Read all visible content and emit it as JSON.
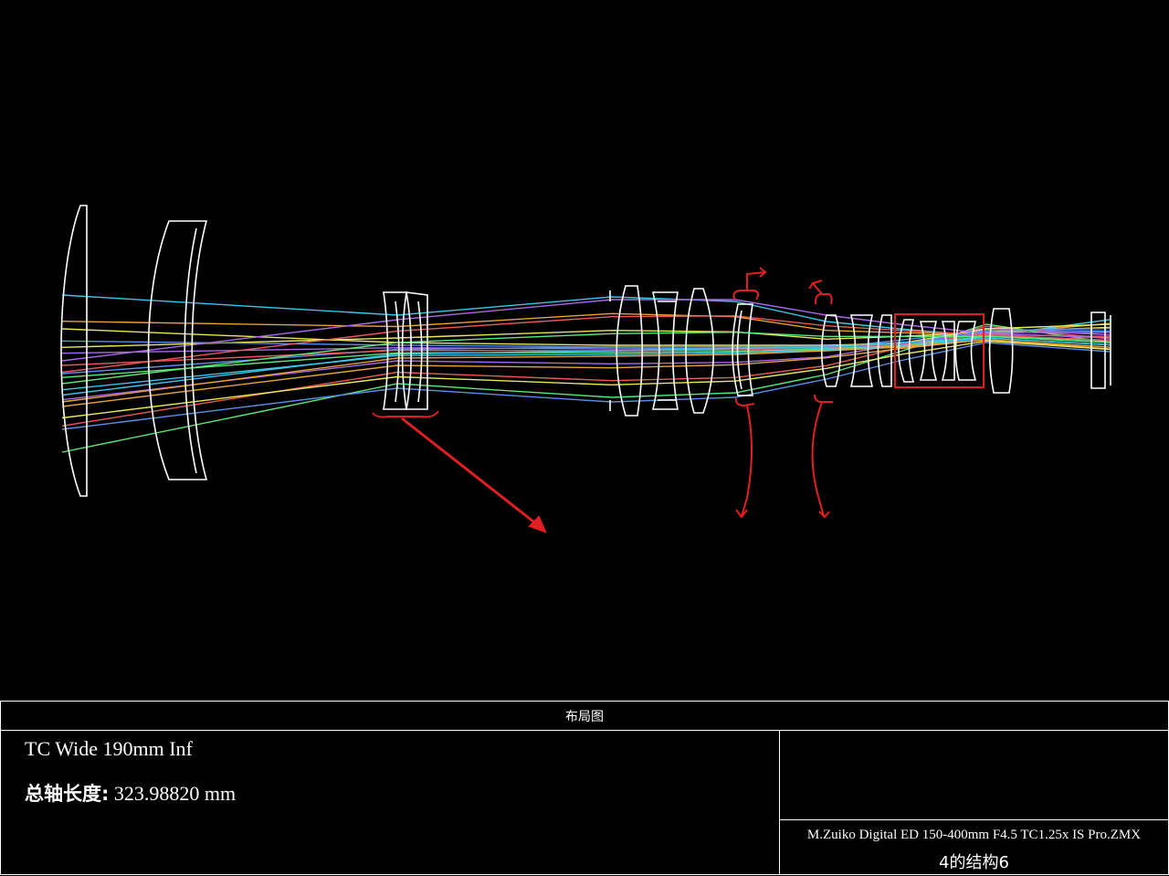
{
  "diagram": {
    "title": "布局图",
    "configuration_name": "TC Wide 190mm Inf",
    "total_axial_length_label": "总轴长度:",
    "total_axial_length_value": "323.98820 mm",
    "file_name": "M.Zuiko Digital ED 150-400mm F4.5 TC1.25x IS Pro.ZMX",
    "configuration_number": "4的结构6"
  },
  "colors": {
    "background": "#000000",
    "lens_outline": "#ffffff",
    "annotation": "#e02020",
    "ray_fields": [
      "#39c6e8",
      "#e8a23a",
      "#e8e85a",
      "#5a8ee8",
      "#a86ae8",
      "#e85a5a",
      "#5ae87a"
    ]
  },
  "icons": {
    "arrow": "red-annotation-arrow",
    "brackets": "red-hand-drawn-bracket"
  }
}
